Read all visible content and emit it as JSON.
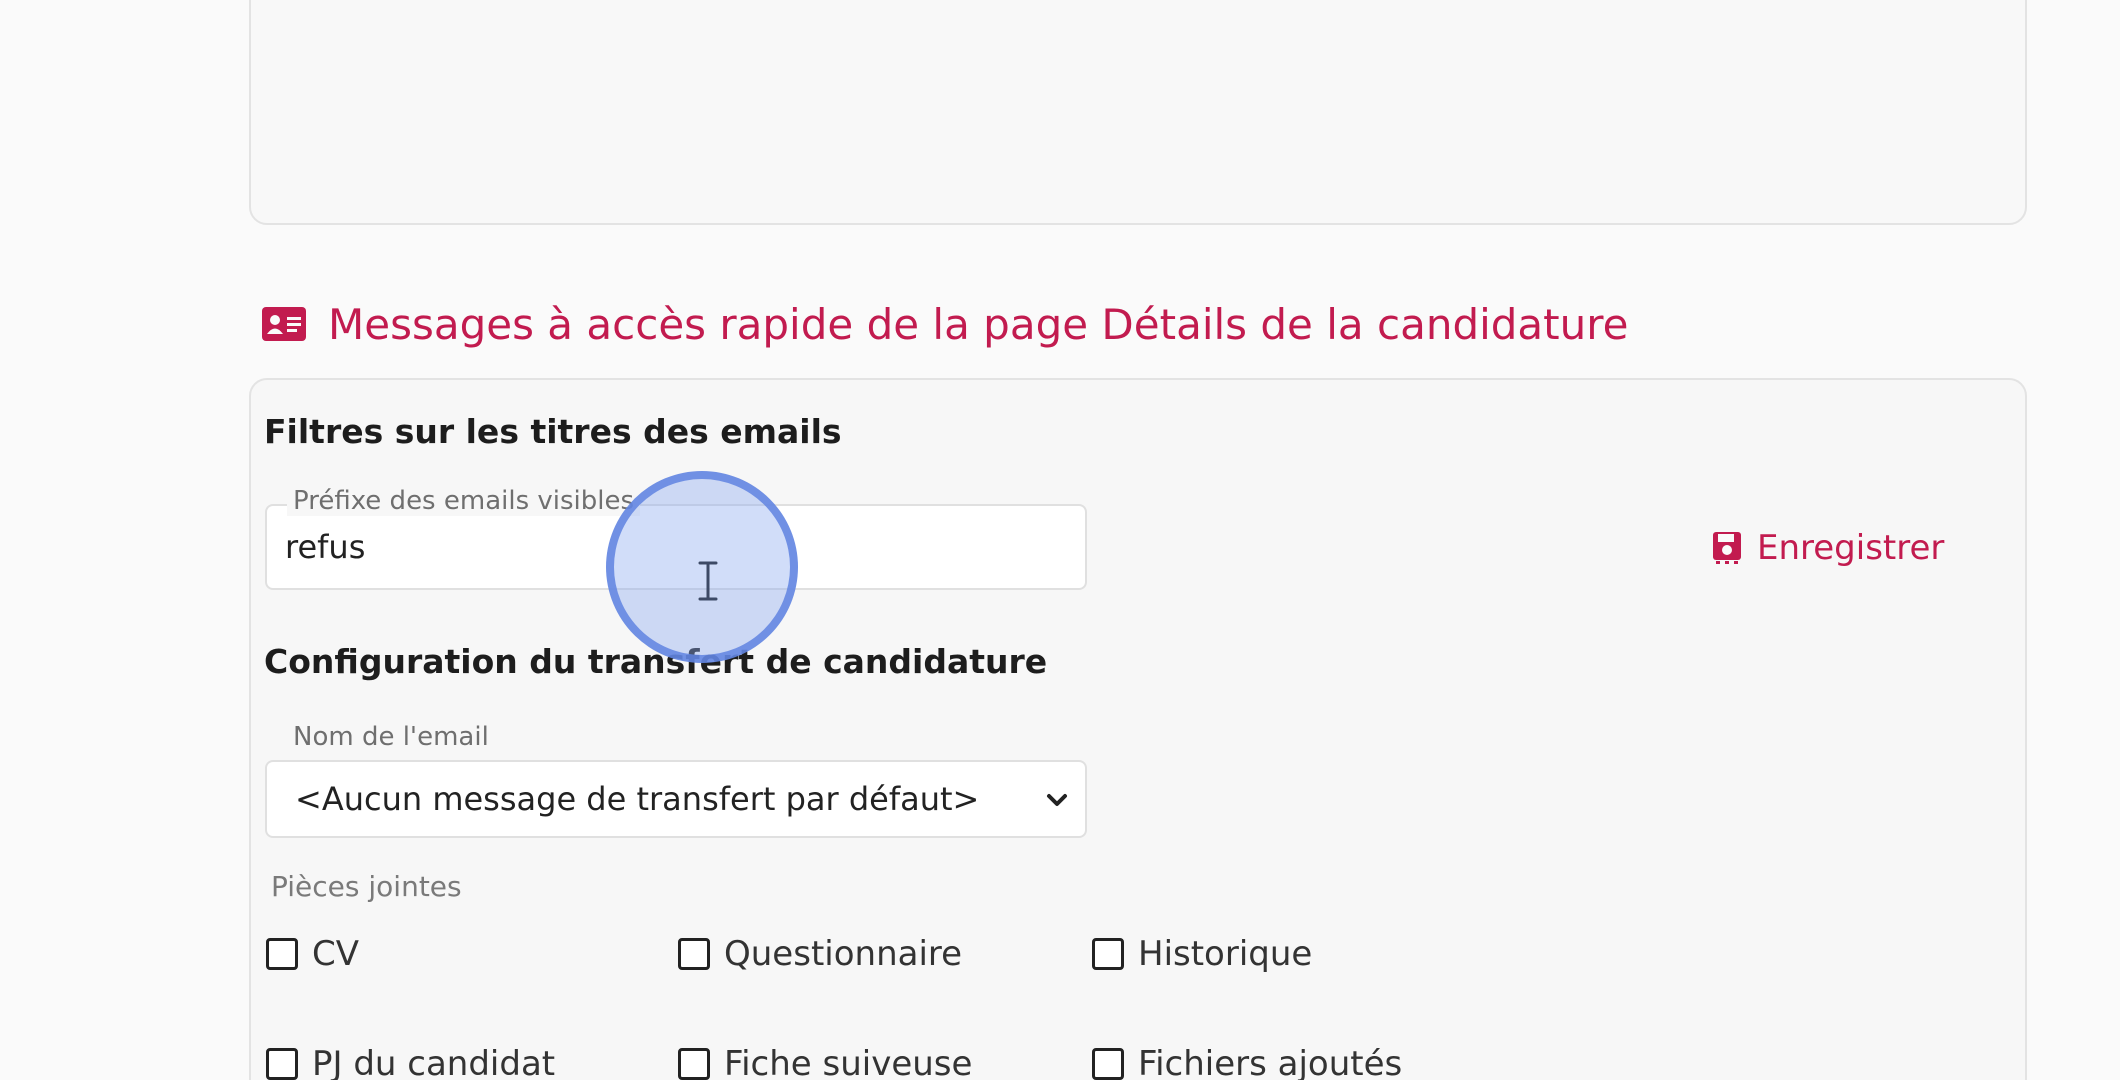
{
  "section": {
    "title": "Messages à accès rapide de la page Détails de la candidature",
    "icon": "id-card-icon",
    "accent_color": "#c21b4f"
  },
  "filters": {
    "heading": "Filtres sur les titres des emails",
    "prefix_field": {
      "label": "Préfixe des emails visibles",
      "value": "refus"
    },
    "save_label": "Enregistrer"
  },
  "transfer": {
    "heading": "Configuration du transfert de candidature",
    "email_name_label": "Nom de l'email",
    "email_name_selected": "<Aucun message de transfert par défaut>",
    "attachments_label": "Pièces jointes",
    "attachments": [
      {
        "label": "CV",
        "checked": false
      },
      {
        "label": "Questionnaire",
        "checked": false
      },
      {
        "label": "Historique",
        "checked": false
      },
      {
        "label": "PJ du candidat",
        "checked": false
      },
      {
        "label": "Fiche suiveuse",
        "checked": false
      },
      {
        "label": "Fichiers ajoutés",
        "checked": false
      }
    ]
  }
}
